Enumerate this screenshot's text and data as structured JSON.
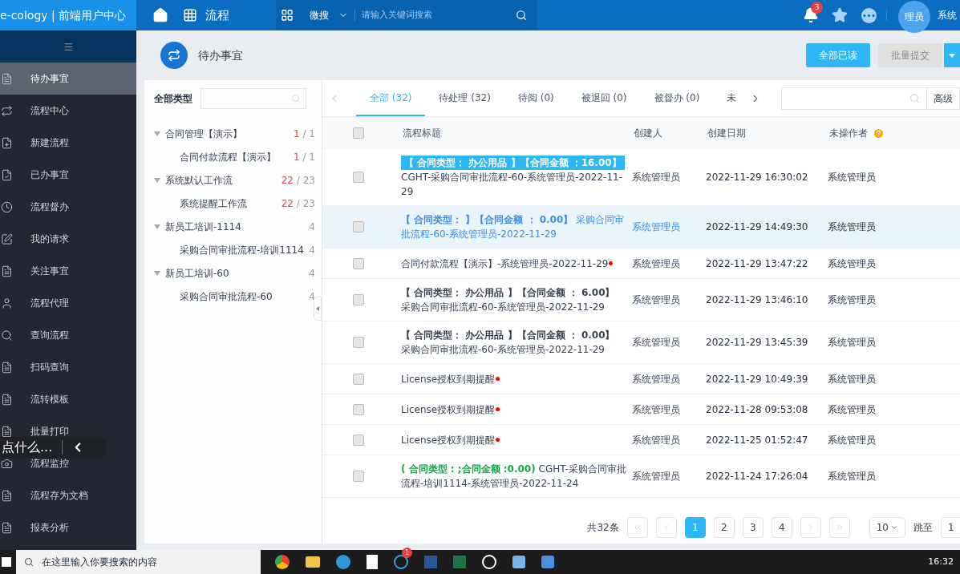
{
  "topbar": {
    "brand": "e-cology | 前端用户中心",
    "module": "流程",
    "search_scope": "微搜",
    "search_placeholder": "请输入关键词搜索",
    "notifications": "3",
    "avatar": "理员",
    "user": "系统"
  },
  "sidebar": {
    "items": [
      {
        "label": "待办事宜",
        "selected": true
      },
      {
        "label": "流程中心",
        "selected": false
      },
      {
        "label": "新建流程",
        "selected": false
      },
      {
        "label": "已办事宜",
        "selected": false
      },
      {
        "label": "流程督办",
        "selected": false
      },
      {
        "label": "我的请求",
        "selected": false
      },
      {
        "label": "关注事宜",
        "selected": false
      },
      {
        "label": "流程代理",
        "selected": false
      },
      {
        "label": "查询流程",
        "selected": false
      },
      {
        "label": "扫码查询",
        "selected": false
      },
      {
        "label": "流转模板",
        "selected": false
      },
      {
        "label": "批量打印",
        "selected": false
      },
      {
        "label": "流程监控",
        "selected": false
      },
      {
        "label": "流程存为文档",
        "selected": false
      },
      {
        "label": "报表分析",
        "selected": false
      }
    ]
  },
  "page": {
    "title": "待办事宜",
    "buttons": [
      {
        "label": "全部已读",
        "disabled": false
      },
      {
        "label": "批量提交",
        "disabled": true
      }
    ]
  },
  "tree": {
    "title": "全部类型",
    "count_separator": "/",
    "items": [
      {
        "label": "合同管理【演示】",
        "unread": "1",
        "total": "1",
        "expanded": true,
        "children": [
          {
            "label": "合同付款流程【演示】",
            "unread": "1",
            "total": "1"
          }
        ]
      },
      {
        "label": "系统默认工作流",
        "unread": "22",
        "total": "23",
        "expanded": true,
        "children": [
          {
            "label": "系统提醒工作流",
            "unread": "22",
            "total": "23"
          }
        ]
      },
      {
        "label": "新员工培训-1114",
        "total": "4",
        "expanded": true,
        "children": [
          {
            "label": "采购合同审批流程-培训1114",
            "total": "4"
          }
        ]
      },
      {
        "label": "新员工培训-60",
        "total": "4",
        "expanded": true,
        "children": [
          {
            "label": "采购合同审批流程-60",
            "total": "4"
          }
        ]
      }
    ]
  },
  "tabs": [
    {
      "label": "全部 (32)",
      "selected": true
    },
    {
      "label": "待处理 (32)",
      "selected": false
    },
    {
      "label": "待阅 (0)",
      "selected": false
    },
    {
      "label": "被退回 (0)",
      "selected": false
    },
    {
      "label": "被督办 (0)",
      "selected": false
    },
    {
      "label": "未",
      "selected": false
    }
  ],
  "advanced": "高级",
  "table": {
    "select_all_checked": false,
    "columns": [
      "流程标题",
      "创建人",
      "创建日期",
      "未操作者"
    ],
    "rows": [
      {
        "kind": "highlight",
        "tag": "【 合同类型： 办公用品 】【合同金额 ：16.00】",
        "text": "CGHT-采购合同审批流程-60-系统管理员-2022-11-29",
        "unread": false,
        "selected": false,
        "checked": false,
        "creator": "系统管理员",
        "date": "2022-11-29 16:30:02",
        "pending": "系统管理员"
      },
      {
        "kind": "bold",
        "tag": "【 合同类型：  】【合同金额 ： 0.00】",
        "text": "采购合同审批流程-60-系统管理员-2022-11-29",
        "unread": false,
        "selected": true,
        "checked": false,
        "creator": "系统管理员",
        "date": "2022-11-29 14:49:30",
        "pending": "系统管理员"
      },
      {
        "kind": "plain",
        "text": "合同付款流程【演示】-系统管理员-2022-11-29",
        "unread": true,
        "selected": false,
        "checked": false,
        "creator": "系统管理员",
        "date": "2022-11-29 13:47:22",
        "pending": "系统管理员"
      },
      {
        "kind": "bold",
        "tag": "【 合同类型： 办公用品 】【合同金额 ： 6.00】",
        "text": "采购合同审批流程-60-系统管理员-2022-11-29",
        "unread": false,
        "selected": false,
        "checked": false,
        "creator": "系统管理员",
        "date": "2022-11-29 13:46:10",
        "pending": "系统管理员"
      },
      {
        "kind": "bold",
        "tag": "【 合同类型： 办公用品 】【合同金额 ： 0.00】",
        "text": "采购合同审批流程-60-系统管理员-2022-11-29",
        "unread": false,
        "selected": false,
        "checked": false,
        "creator": "系统管理员",
        "date": "2022-11-29 13:45:39",
        "pending": "系统管理员"
      },
      {
        "kind": "plain",
        "text": "License授权到期提醒",
        "unread": true,
        "selected": false,
        "checked": false,
        "creator": "系统管理员",
        "date": "2022-11-29 10:49:39",
        "pending": "系统管理员"
      },
      {
        "kind": "plain",
        "text": "License授权到期提醒",
        "unread": true,
        "selected": false,
        "checked": false,
        "creator": "系统管理员",
        "date": "2022-11-28 09:53:08",
        "pending": "系统管理员"
      },
      {
        "kind": "plain",
        "text": "License授权到期提醒",
        "unread": true,
        "selected": false,
        "checked": false,
        "creator": "系统管理员",
        "date": "2022-11-25 01:52:47",
        "pending": "系统管理员"
      },
      {
        "kind": "green",
        "tag": "( 合同类型 : ;合同金额 :0.00)",
        "text": "CGHT-采购合同审批流程-培训1114-系统管理员-2022-11-24",
        "unread": false,
        "selected": false,
        "checked": false,
        "creator": "系统管理员",
        "date": "2022-11-24 17:26:04",
        "pending": "系统管理员"
      }
    ]
  },
  "pagination": {
    "total": "共32条",
    "pages": [
      {
        "label": "1",
        "selected": true
      },
      {
        "label": "2",
        "selected": false
      },
      {
        "label": "3",
        "selected": false
      },
      {
        "label": "4",
        "selected": false
      }
    ],
    "page_size": "10",
    "jump_label": "跳至",
    "jump_value": "1"
  },
  "overlay": {
    "text": "点什么..."
  },
  "taskbar": {
    "search_placeholder": "在这里输入你要搜索的内容",
    "badge": "1",
    "time": "16:32"
  }
}
